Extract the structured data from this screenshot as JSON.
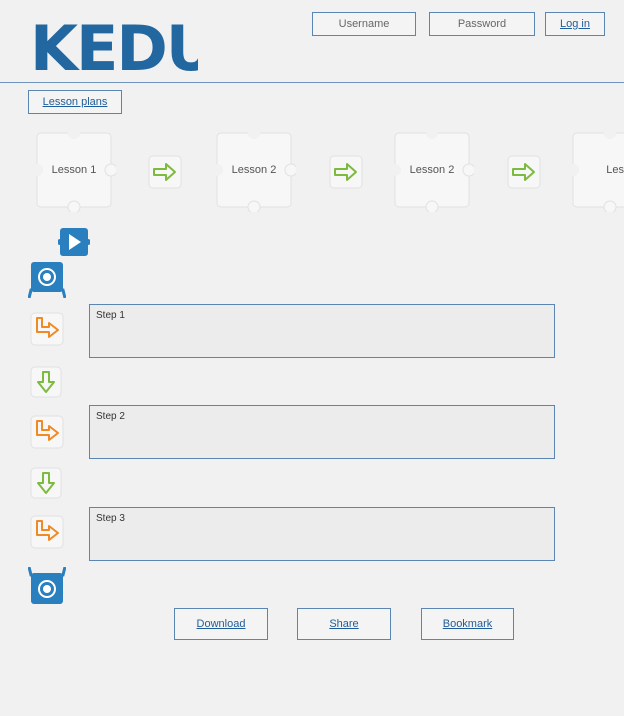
{
  "brand": {
    "logo_text": "KEDU",
    "color": "#2267a0"
  },
  "header": {
    "username_placeholder": "Username",
    "password_placeholder": "Password",
    "login_label": "Log in"
  },
  "nav": {
    "lesson_plans_label": "Lesson plans"
  },
  "lessons": [
    {
      "label": "Lesson 1"
    },
    {
      "label": "Lesson 2"
    },
    {
      "label": "Lesson 2"
    },
    {
      "label": "Lesson"
    }
  ],
  "steps": [
    {
      "label": "Step 1"
    },
    {
      "label": "Step 2"
    },
    {
      "label": "Step 3"
    }
  ],
  "actions": {
    "download_label": "Download",
    "share_label": "Share",
    "bookmark_label": "Bookmark"
  },
  "colors": {
    "accent": "#2a7fbf",
    "arrow_green": "#7dbb3f",
    "arrow_orange": "#f08a24",
    "border_blue": "#5b86b2"
  },
  "icons": [
    "play-icon",
    "start-block-icon",
    "turn-arrow-icon",
    "down-arrow-icon",
    "right-arrow-icon",
    "end-block-icon"
  ]
}
